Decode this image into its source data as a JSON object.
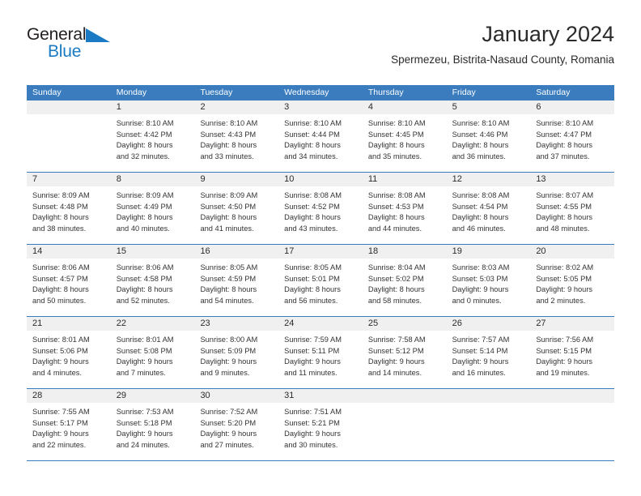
{
  "brand": {
    "name_part1": "General",
    "name_part2": "Blue",
    "triangle_color": "#1a7ac4",
    "text_color": "#231f20"
  },
  "header": {
    "title": "January 2024",
    "subtitle": "Spermezeu, Bistrita-Nasaud County, Romania"
  },
  "colors": {
    "header_blue": "#3a7cbe",
    "daynum_band": "#f0f0f0",
    "body_text": "#333333"
  },
  "weekdays": [
    "Sunday",
    "Monday",
    "Tuesday",
    "Wednesday",
    "Thursday",
    "Friday",
    "Saturday"
  ],
  "weeks": [
    [
      {
        "day": "",
        "sunrise": "",
        "sunset": "",
        "daylight_l1": "",
        "daylight_l2": ""
      },
      {
        "day": "1",
        "sunrise": "Sunrise: 8:10 AM",
        "sunset": "Sunset: 4:42 PM",
        "daylight_l1": "Daylight: 8 hours",
        "daylight_l2": "and 32 minutes."
      },
      {
        "day": "2",
        "sunrise": "Sunrise: 8:10 AM",
        "sunset": "Sunset: 4:43 PM",
        "daylight_l1": "Daylight: 8 hours",
        "daylight_l2": "and 33 minutes."
      },
      {
        "day": "3",
        "sunrise": "Sunrise: 8:10 AM",
        "sunset": "Sunset: 4:44 PM",
        "daylight_l1": "Daylight: 8 hours",
        "daylight_l2": "and 34 minutes."
      },
      {
        "day": "4",
        "sunrise": "Sunrise: 8:10 AM",
        "sunset": "Sunset: 4:45 PM",
        "daylight_l1": "Daylight: 8 hours",
        "daylight_l2": "and 35 minutes."
      },
      {
        "day": "5",
        "sunrise": "Sunrise: 8:10 AM",
        "sunset": "Sunset: 4:46 PM",
        "daylight_l1": "Daylight: 8 hours",
        "daylight_l2": "and 36 minutes."
      },
      {
        "day": "6",
        "sunrise": "Sunrise: 8:10 AM",
        "sunset": "Sunset: 4:47 PM",
        "daylight_l1": "Daylight: 8 hours",
        "daylight_l2": "and 37 minutes."
      }
    ],
    [
      {
        "day": "7",
        "sunrise": "Sunrise: 8:09 AM",
        "sunset": "Sunset: 4:48 PM",
        "daylight_l1": "Daylight: 8 hours",
        "daylight_l2": "and 38 minutes."
      },
      {
        "day": "8",
        "sunrise": "Sunrise: 8:09 AM",
        "sunset": "Sunset: 4:49 PM",
        "daylight_l1": "Daylight: 8 hours",
        "daylight_l2": "and 40 minutes."
      },
      {
        "day": "9",
        "sunrise": "Sunrise: 8:09 AM",
        "sunset": "Sunset: 4:50 PM",
        "daylight_l1": "Daylight: 8 hours",
        "daylight_l2": "and 41 minutes."
      },
      {
        "day": "10",
        "sunrise": "Sunrise: 8:08 AM",
        "sunset": "Sunset: 4:52 PM",
        "daylight_l1": "Daylight: 8 hours",
        "daylight_l2": "and 43 minutes."
      },
      {
        "day": "11",
        "sunrise": "Sunrise: 8:08 AM",
        "sunset": "Sunset: 4:53 PM",
        "daylight_l1": "Daylight: 8 hours",
        "daylight_l2": "and 44 minutes."
      },
      {
        "day": "12",
        "sunrise": "Sunrise: 8:08 AM",
        "sunset": "Sunset: 4:54 PM",
        "daylight_l1": "Daylight: 8 hours",
        "daylight_l2": "and 46 minutes."
      },
      {
        "day": "13",
        "sunrise": "Sunrise: 8:07 AM",
        "sunset": "Sunset: 4:55 PM",
        "daylight_l1": "Daylight: 8 hours",
        "daylight_l2": "and 48 minutes."
      }
    ],
    [
      {
        "day": "14",
        "sunrise": "Sunrise: 8:06 AM",
        "sunset": "Sunset: 4:57 PM",
        "daylight_l1": "Daylight: 8 hours",
        "daylight_l2": "and 50 minutes."
      },
      {
        "day": "15",
        "sunrise": "Sunrise: 8:06 AM",
        "sunset": "Sunset: 4:58 PM",
        "daylight_l1": "Daylight: 8 hours",
        "daylight_l2": "and 52 minutes."
      },
      {
        "day": "16",
        "sunrise": "Sunrise: 8:05 AM",
        "sunset": "Sunset: 4:59 PM",
        "daylight_l1": "Daylight: 8 hours",
        "daylight_l2": "and 54 minutes."
      },
      {
        "day": "17",
        "sunrise": "Sunrise: 8:05 AM",
        "sunset": "Sunset: 5:01 PM",
        "daylight_l1": "Daylight: 8 hours",
        "daylight_l2": "and 56 minutes."
      },
      {
        "day": "18",
        "sunrise": "Sunrise: 8:04 AM",
        "sunset": "Sunset: 5:02 PM",
        "daylight_l1": "Daylight: 8 hours",
        "daylight_l2": "and 58 minutes."
      },
      {
        "day": "19",
        "sunrise": "Sunrise: 8:03 AM",
        "sunset": "Sunset: 5:03 PM",
        "daylight_l1": "Daylight: 9 hours",
        "daylight_l2": "and 0 minutes."
      },
      {
        "day": "20",
        "sunrise": "Sunrise: 8:02 AM",
        "sunset": "Sunset: 5:05 PM",
        "daylight_l1": "Daylight: 9 hours",
        "daylight_l2": "and 2 minutes."
      }
    ],
    [
      {
        "day": "21",
        "sunrise": "Sunrise: 8:01 AM",
        "sunset": "Sunset: 5:06 PM",
        "daylight_l1": "Daylight: 9 hours",
        "daylight_l2": "and 4 minutes."
      },
      {
        "day": "22",
        "sunrise": "Sunrise: 8:01 AM",
        "sunset": "Sunset: 5:08 PM",
        "daylight_l1": "Daylight: 9 hours",
        "daylight_l2": "and 7 minutes."
      },
      {
        "day": "23",
        "sunrise": "Sunrise: 8:00 AM",
        "sunset": "Sunset: 5:09 PM",
        "daylight_l1": "Daylight: 9 hours",
        "daylight_l2": "and 9 minutes."
      },
      {
        "day": "24",
        "sunrise": "Sunrise: 7:59 AM",
        "sunset": "Sunset: 5:11 PM",
        "daylight_l1": "Daylight: 9 hours",
        "daylight_l2": "and 11 minutes."
      },
      {
        "day": "25",
        "sunrise": "Sunrise: 7:58 AM",
        "sunset": "Sunset: 5:12 PM",
        "daylight_l1": "Daylight: 9 hours",
        "daylight_l2": "and 14 minutes."
      },
      {
        "day": "26",
        "sunrise": "Sunrise: 7:57 AM",
        "sunset": "Sunset: 5:14 PM",
        "daylight_l1": "Daylight: 9 hours",
        "daylight_l2": "and 16 minutes."
      },
      {
        "day": "27",
        "sunrise": "Sunrise: 7:56 AM",
        "sunset": "Sunset: 5:15 PM",
        "daylight_l1": "Daylight: 9 hours",
        "daylight_l2": "and 19 minutes."
      }
    ],
    [
      {
        "day": "28",
        "sunrise": "Sunrise: 7:55 AM",
        "sunset": "Sunset: 5:17 PM",
        "daylight_l1": "Daylight: 9 hours",
        "daylight_l2": "and 22 minutes."
      },
      {
        "day": "29",
        "sunrise": "Sunrise: 7:53 AM",
        "sunset": "Sunset: 5:18 PM",
        "daylight_l1": "Daylight: 9 hours",
        "daylight_l2": "and 24 minutes."
      },
      {
        "day": "30",
        "sunrise": "Sunrise: 7:52 AM",
        "sunset": "Sunset: 5:20 PM",
        "daylight_l1": "Daylight: 9 hours",
        "daylight_l2": "and 27 minutes."
      },
      {
        "day": "31",
        "sunrise": "Sunrise: 7:51 AM",
        "sunset": "Sunset: 5:21 PM",
        "daylight_l1": "Daylight: 9 hours",
        "daylight_l2": "and 30 minutes."
      },
      {
        "day": "",
        "sunrise": "",
        "sunset": "",
        "daylight_l1": "",
        "daylight_l2": ""
      },
      {
        "day": "",
        "sunrise": "",
        "sunset": "",
        "daylight_l1": "",
        "daylight_l2": ""
      },
      {
        "day": "",
        "sunrise": "",
        "sunset": "",
        "daylight_l1": "",
        "daylight_l2": ""
      }
    ]
  ]
}
